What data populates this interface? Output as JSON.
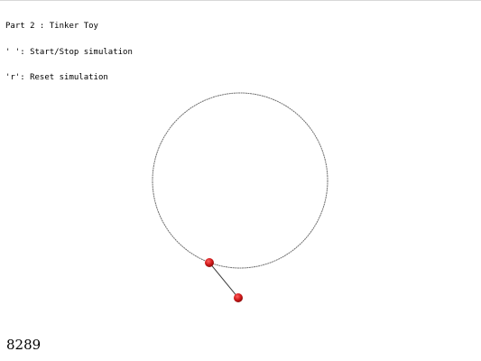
{
  "window": {
    "background": "#ffffff"
  },
  "help_text": {
    "line1": "Part 2 : Tinker Toy",
    "line2": "' ': Start/Stop simulation",
    "line3": "'r': Reset simulation"
  },
  "frame_counter": "8289",
  "scene": {
    "constraint_circle_color": "#707070",
    "rod_color": "#404040",
    "particle_color": "#d01818",
    "particle_highlight": "#ff6060",
    "particle_count": 2
  }
}
